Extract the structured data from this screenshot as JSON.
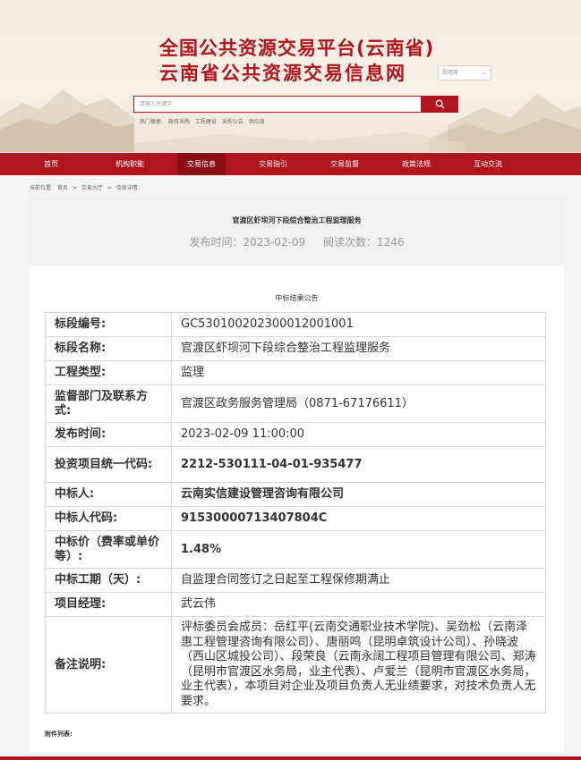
{
  "header": {
    "title_line1": "全国公共资源交易平台(云南省)",
    "title_line2": "云南省公共资源交易信息网",
    "city_select": "昆明市",
    "search_placeholder": "请输入关键字",
    "hot_label": "热门搜索:",
    "hot_items": [
      "政府采购",
      "工程建设",
      "采购公告",
      "供应商"
    ]
  },
  "nav": {
    "items": [
      "首页",
      "机构职能",
      "交易信息",
      "交易指引",
      "交易监督",
      "政策法规",
      "互动交流"
    ],
    "active_index": 2
  },
  "breadcrumb": {
    "prefix": "当前位置:",
    "items": [
      "首页",
      "交易大厅",
      "交易详情"
    ],
    "sep": ">"
  },
  "article": {
    "title": "官渡区虾坝河下段综合整治工程监理服务",
    "publish_time": "发布时间：2023-02-09",
    "read_count": "阅读次数：1246",
    "subtitle": "中标结果公告"
  },
  "table": {
    "rows": [
      {
        "key": "标段编号:",
        "value": "GC5301002023000120010​01"
      },
      {
        "key": "标段名称:",
        "value": "官渡区虾坝河下段综合整治工程监理服务"
      },
      {
        "key": "工程类型:",
        "value": "监理"
      },
      {
        "key": "监督部门及联系方式:",
        "value": "官渡区政务服务管理局（0871-67176611）"
      },
      {
        "key": "发布时间:",
        "value": "2023-02-09 11:00:00"
      },
      {
        "key": "投资项目统一代码:",
        "value": "2212-530111-04-01-935477"
      },
      {
        "key": "中标人:",
        "value": "云南实信建设管理咨询有限公司"
      },
      {
        "key": "中标人代码:",
        "value": "91530000713407804C"
      },
      {
        "key": "中标价（费率或单价等）:",
        "value": "1.48%"
      },
      {
        "key": "中标工期（天）:",
        "value": "自监理合同签订之日起至工程保修期满止"
      },
      {
        "key": "项目经理:",
        "value": "武云伟"
      },
      {
        "key": "备注说明:",
        "value": "评标委员会成员：岳红平(云南交通职业技术学院)、吴劲松（云南泽惠工程管理咨询有限公司）、唐丽鸣（昆明卓筑设计公司）、孙晓波（西山区城投公司）、段荣良（云南永阔工程项目管理有限公司、郑涛（昆明市官渡区水务局，业主代表）、卢爱兰（昆明市官渡区水务局，业主代表），本项目对企业及项目负责人无业绩要求，对技术负责人无要求。"
      }
    ]
  },
  "attachments_label": "附件列表:",
  "colors": {
    "brand_red": "#b0141d",
    "nav_active": "#8a0d14"
  }
}
